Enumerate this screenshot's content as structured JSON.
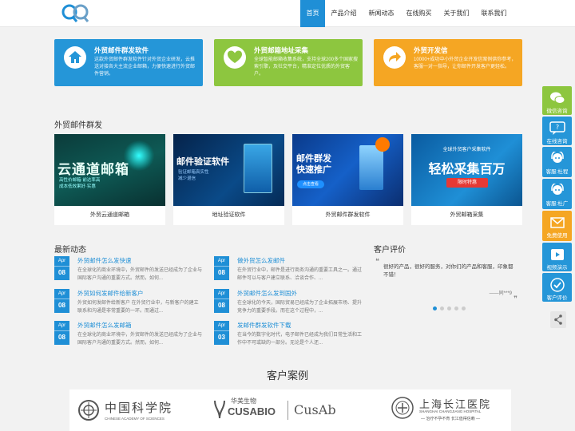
{
  "nav": {
    "items": [
      "首页",
      "产品介绍",
      "新闻动态",
      "在线购买",
      "关于我们",
      "联系我们"
    ],
    "active_index": 0
  },
  "features": [
    {
      "title": "外贸邮件群发软件",
      "desc": "这款外贸邮件群发软件针对外贸企业研发，云推送对接各大主流企业邮箱，力便快速进行外贸邮件营销。",
      "color": "#2596d8",
      "icon": "house-icon"
    },
    {
      "title": "外贸邮箱地址采集",
      "desc": "全球智能邮箱收集系统，支持全球200多个国家搜索引擎，及社交平台，精准定位优质的外贸客户。",
      "color": "#8dc63f",
      "icon": "heart-icon"
    },
    {
      "title": "外贸开发信",
      "desc": "10000+成功中小外贸企业开发信案例供你参考，客服一对一指导，让你邮件开发客户更轻松。",
      "color": "#f5a623",
      "icon": "arrow-icon"
    }
  ],
  "products_section": {
    "title": "外贸邮件群发",
    "items": [
      {
        "caption": "外贸云通道邮箱",
        "banner": "云通道邮箱",
        "sub": "高性价邮箱·前达率高\n成本低效果好·实惠"
      },
      {
        "caption": "地址验证软件",
        "banner": "邮件验证软件",
        "sub": "验证邮箱真实性\n减少退信"
      },
      {
        "caption": "外贸邮件群发软件",
        "banner": "邮件群发\n快速推广",
        "sub": "点击查看"
      },
      {
        "caption": "外贸邮箱采集",
        "banner": "轻松采集百万",
        "sub": "全球外贸客户采集软件",
        "badge": "限时特惠"
      }
    ]
  },
  "news_section": {
    "title": "最新动态",
    "items": [
      {
        "month": "Apr",
        "day": "08",
        "title": "外贸邮件怎么发快速",
        "desc": "在全球化的商业环境中，外贸邮件的发送已经成为了企业与国际客户沟通的重要方式。然而，如何..."
      },
      {
        "month": "Apr",
        "day": "08",
        "title": "做外贸怎么发邮件",
        "desc": "在外贸行业中，邮件是进行商务沟通的重要工具之一。通过邮件可以与客户建立联系、洽谈合作、..."
      },
      {
        "month": "Apr",
        "day": "08",
        "title": "外贸如何发邮件给新客户",
        "desc": "外贸如何发邮件给新客户 在外贸行业中，与新客户的建立联系和沟通是非常重要的一环。而通过..."
      },
      {
        "month": "Apr",
        "day": "08",
        "title": "外贸邮件怎么发到国外",
        "desc": "在全球化的今天，国际贸易已经成为了企业拓展市场、提升竞争力的重要手段。而在这个过程中，..."
      },
      {
        "month": "Apr",
        "day": "08",
        "title": "外贸邮件怎么发邮箱",
        "desc": "在全球化的商业环境中，外贸邮件的发送已经成为了企业与国际客户沟通的重要方式。然而，如何..."
      },
      {
        "month": "Apr",
        "day": "03",
        "title": "发邮件群发软件下载",
        "desc": "在当今的数字化时代，电子邮件已经成为我们日常生活和工作中不可或缺的一部分。无论是个人还..."
      }
    ]
  },
  "review_section": {
    "title": "客户评价",
    "text": "很好的产品，很好的服务，对你们的产品和客服，印象都不错！",
    "author": "——同***9",
    "dots": 5,
    "active_dot": 0
  },
  "cases_section": {
    "title": "客户案例",
    "logos": [
      {
        "name": "中国科学院",
        "sub": "CHINESE ACADEMY OF SCIENCES"
      },
      {
        "name": "华美生物",
        "sub": "CUSABIO",
        "mark": "CusAb"
      },
      {
        "name": "上海长江医院",
        "sub": "SHANGHAI CHANGJIANG HOSPITAL",
        "motto": "— 治疗不孕不育 长江值得信赖 —"
      }
    ]
  },
  "sidebar": [
    {
      "label": "微信咨询",
      "color": "#8dc63f",
      "icon": "wechat-icon"
    },
    {
      "label": "在线咨询",
      "color": "#2596d8",
      "icon": "chat-icon"
    },
    {
      "label": "客服:杜程",
      "color": "#2596d8",
      "icon": "headset-icon"
    },
    {
      "label": "客服:杜广",
      "color": "#2596d8",
      "icon": "headset-icon"
    },
    {
      "label": "免费使用",
      "color": "#f5a623",
      "icon": "mail-icon"
    },
    {
      "label": "视频演示",
      "color": "#2596d8",
      "icon": "video-icon"
    },
    {
      "label": "客户评价",
      "color": "#2596d8",
      "icon": "check-icon"
    }
  ]
}
